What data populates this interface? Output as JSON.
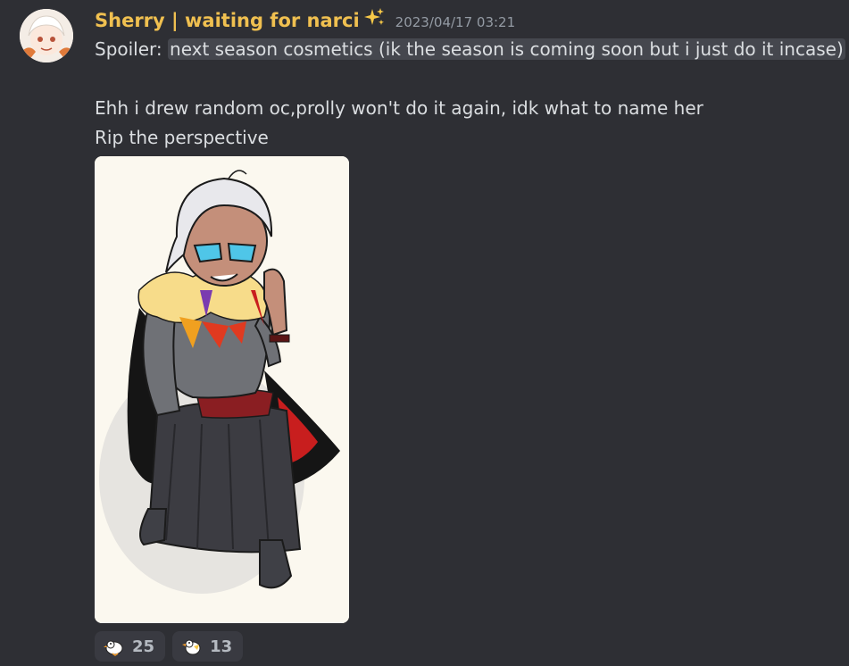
{
  "message": {
    "username": "Sherry | waiting for narci",
    "timestamp": "2023/04/17 03:21",
    "spoiler_prefix": "Spoiler: ",
    "spoiler_text": "next season cosmetics (ik the season is coming soon but i just do it incase)",
    "line2": "Ehh i drew random oc,prolly won't do it again, idk what to name her",
    "line3": "Rip the perspective"
  },
  "reactions": [
    {
      "icon": "duck-emoji-icon",
      "count": "25"
    },
    {
      "icon": "duck-emoji-icon",
      "count": "13"
    }
  ],
  "colors": {
    "background": "#2e2f34",
    "username": "#f0c050",
    "text": "#dbdee1",
    "timestamp": "#949ba4",
    "spoiler_bg": "#45474e",
    "reaction_bg": "#393a41"
  }
}
